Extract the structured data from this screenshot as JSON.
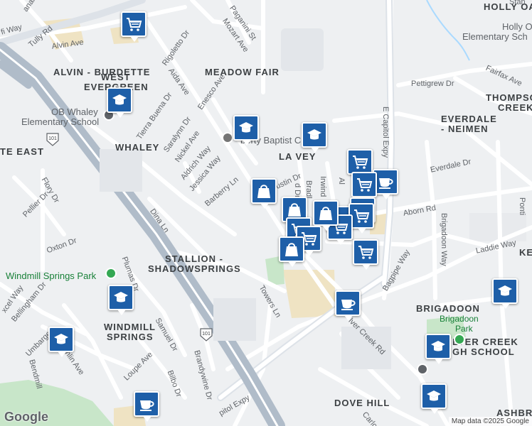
{
  "map": {
    "logo": "Google",
    "attribution": "Map data ©2025 Google",
    "neighborhoods": {
      "holly_oaks": "HOLLY OAKS",
      "alvin_burdette": "ALVIN - BURDETTE",
      "meadow_fair": "MEADOW FAIR",
      "west_evergreen_1": "WEST",
      "west_evergreen_2": "EVERGREEN",
      "thompson_creek_1": "THOMPSON",
      "thompson_creek_2": "CREEK",
      "everdale_neimen_1": "EVERDALE",
      "everdale_neimen_2": "- NEIMEN",
      "whaley": "WHALEY",
      "la_vey": "LA VEY",
      "east": "TE EAST",
      "stallion": "STALLION -",
      "shadowsprings": "SHADOWSPRINGS",
      "ke": "KE",
      "windmill_1": "WINDMILL",
      "windmill_2": "SPRINGS",
      "brigadoon": "BRIGADOON",
      "dove_hill": "DOVE HILL",
      "ashbri": "ASHBRI",
      "silver_creek_hs_1": "LVER CREEK",
      "silver_creek_hs_2": "GH SCHOOL"
    },
    "pois": {
      "holly_oaks_school_1": "Holly O",
      "holly_oaks_school_2": "Elementary Sch",
      "ob_whaley_1": "OB Whaley",
      "ob_whaley_2": "Elementary School",
      "liberty_baptist": "berty Baptist Church",
      "windmill_park": "Windmill Springs Park",
      "brigadoon_park_1": "Brigadoon",
      "brigadoon_park_2": "Park"
    },
    "streets": {
      "tully_rd": "Tully Rd",
      "alvin_ave": "Alvin Ave",
      "way_nw": "fi Way",
      "anal_ave": "anal Ave",
      "paganini": "Paganini St",
      "mozart": "Mozart Ave",
      "rigoletto": "Rigoletto Dr",
      "aida": "Aida Ave",
      "enesco": "Enesco Ave",
      "tierra_buena": "Tierra Buena Dr",
      "saralynn": "Saralynn Dr",
      "nickel": "Nickel Ave",
      "aldrich": "Aldrich Way",
      "jessica": "Jessica Way",
      "barberry": "Barberry Ln",
      "flory": "Flory Dr",
      "pellier": "Pellier Dr",
      "oxton": "Oxton Dr",
      "dina": "Dina Ln",
      "plumas": "Plumas Dr",
      "towers": "Towers Ln",
      "e_capitol": "E Capitol Expy",
      "pettigrew": "Pettigrew Dr",
      "fairfax": "Fairfax Ave",
      "everdale_dr": "Everdale Dr",
      "aborn": "Aborn Rd",
      "brigadoon_way": "Brigadoon Way",
      "laddie": "Laddie Way",
      "bagpipe": "Bagpipe Way",
      "silver_creek_rd": "lver Creek Rd",
      "bellingham": "Bellingham Dr",
      "umbarger": "Umbarger",
      "mclaughlin": "McLaughlin Ave",
      "bendmill": "Bendmill",
      "samuel": "Samuel Dr",
      "loupe": "Loupe Ave",
      "bilbo": "Bilbo Dr",
      "brandywine": "Brandywine Dr",
      "capitol_expy_s": "pitol Expy",
      "austin": "ustin Dr",
      "bradley": "Bradl",
      "irwind": "Irwind",
      "dr_fragment": "d Dr",
      "ai": "Al",
      "excel": "xcel Way",
      "carlc": "Carlc",
      "pont": "Ponti",
      "stan": "Stan"
    },
    "highway_shields": [
      "101",
      "101"
    ],
    "colors": {
      "pin_blue": "#1e5fa8",
      "freeway": "#b0bcc9",
      "road": "#ffffff",
      "park_green": "#c8e6c9",
      "commercial": "#efe3c3",
      "water": "#aadaff"
    },
    "pins": [
      {
        "type": "shopping-cart",
        "name": "pin-shop-1"
      },
      {
        "type": "school",
        "name": "pin-school-1"
      },
      {
        "type": "school",
        "name": "pin-school-2"
      },
      {
        "type": "school",
        "name": "pin-school-3"
      },
      {
        "type": "shopping-bag",
        "name": "pin-bag-1"
      },
      {
        "type": "shopping-cart",
        "name": "pin-shop-2"
      },
      {
        "type": "cafe",
        "name": "pin-cafe-1"
      },
      {
        "type": "shopping-cart",
        "name": "pin-shop-3"
      },
      {
        "type": "shopping-bag",
        "name": "pin-bag-2"
      },
      {
        "type": "shopping-cart",
        "name": "pin-shop-4"
      },
      {
        "type": "shopping-cart",
        "name": "pin-shop-5"
      },
      {
        "type": "shopping-cart",
        "name": "pin-shop-6"
      },
      {
        "type": "shopping-cart",
        "name": "pin-shop-7"
      },
      {
        "type": "shopping-bag",
        "name": "pin-bag-3"
      },
      {
        "type": "shopping-cart",
        "name": "pin-shop-8"
      },
      {
        "type": "shopping-cart",
        "name": "pin-shop-9"
      },
      {
        "type": "shopping-bag",
        "name": "pin-bag-4"
      },
      {
        "type": "shopping-cart",
        "name": "pin-shop-10"
      },
      {
        "type": "school",
        "name": "pin-school-4"
      },
      {
        "type": "school",
        "name": "pin-school-5"
      },
      {
        "type": "cafe",
        "name": "pin-cafe-2"
      },
      {
        "type": "school",
        "name": "pin-school-6"
      },
      {
        "type": "school",
        "name": "pin-school-7"
      },
      {
        "type": "school",
        "name": "pin-school-8"
      },
      {
        "type": "cafe",
        "name": "pin-cafe-3"
      }
    ]
  }
}
